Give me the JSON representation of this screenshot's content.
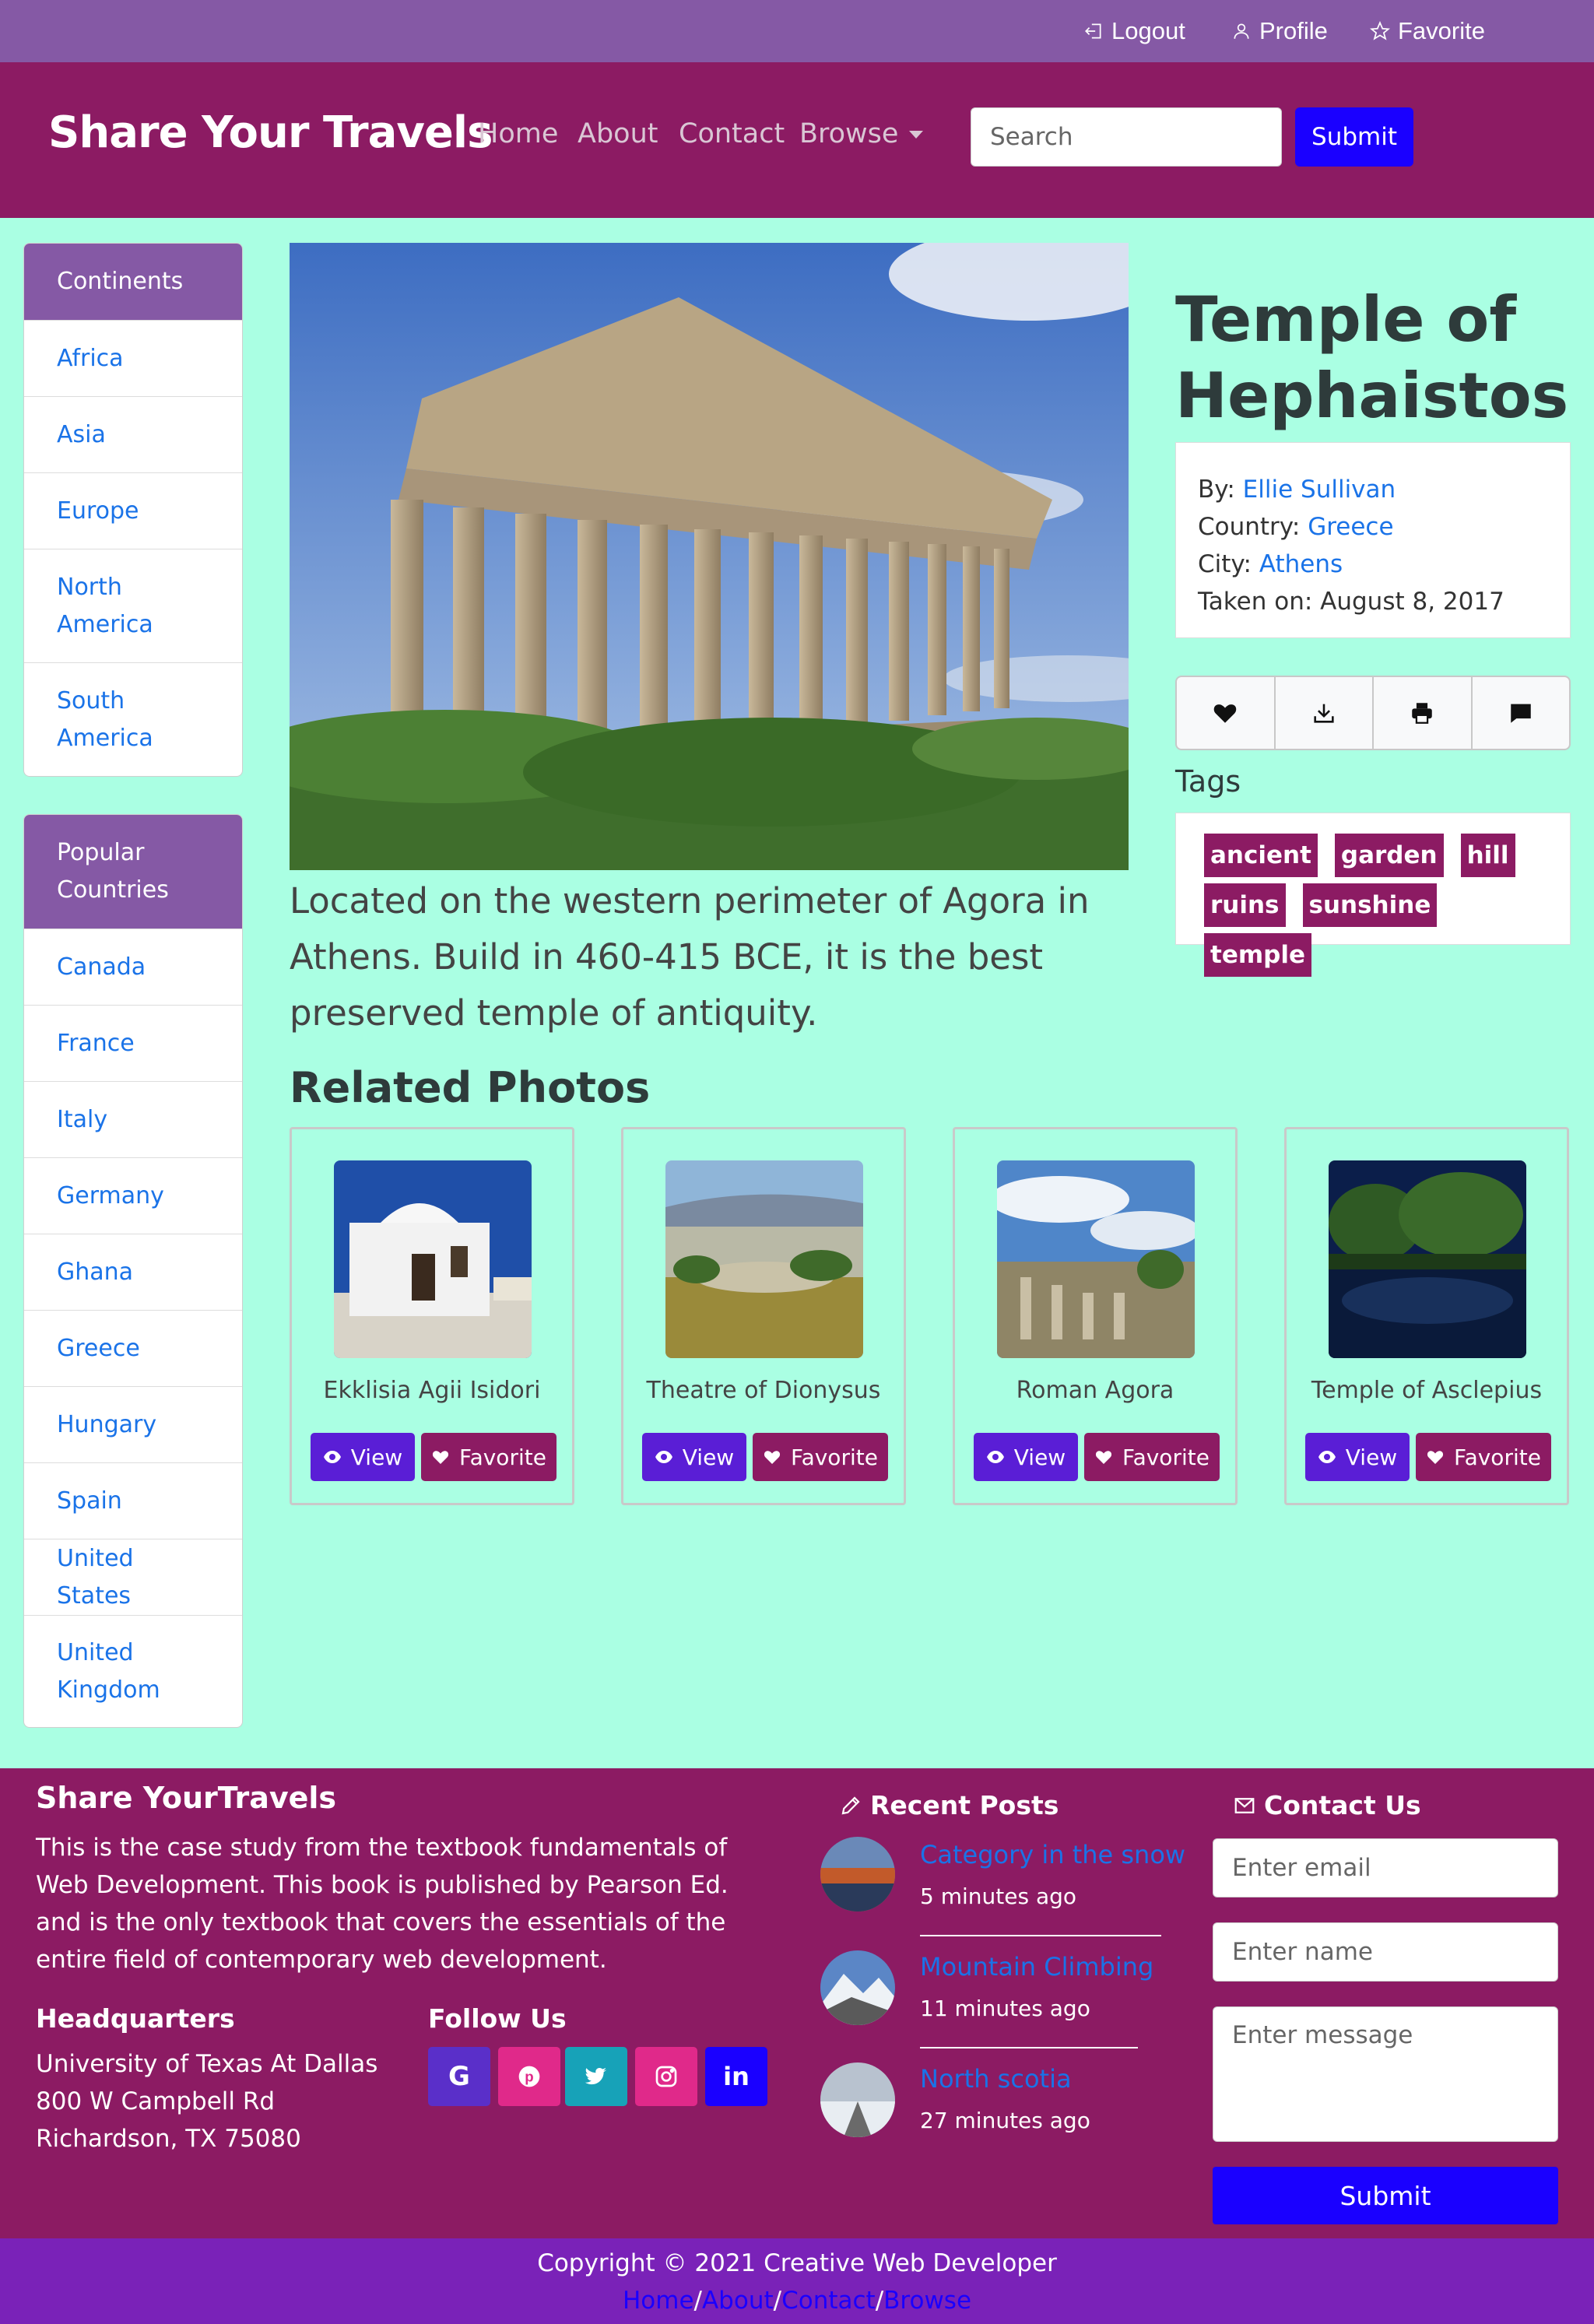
{
  "topbar": {
    "logout": "Logout",
    "profile": "Profile",
    "favorite": "Favorite"
  },
  "navbar": {
    "brand": "Share Your Travels",
    "links": [
      "Home",
      "About",
      "Contact",
      "Browse"
    ],
    "search_placeholder": "Search",
    "submit": "Submit"
  },
  "sidebar": {
    "continents_title": "Continents",
    "continents": [
      "Africa",
      "Asia",
      "Europe",
      "North America",
      "South America"
    ],
    "countries_title": "Popular Countries",
    "countries": [
      "Canada",
      "France",
      "Italy",
      "Germany",
      "Ghana",
      "Greece",
      "Hungary",
      "Spain",
      "United States",
      "United Kingdom"
    ]
  },
  "photo": {
    "title": "Temple of Hephaistos",
    "description": "Located on the western perimeter of Agora in Athens. Build in 460-415 BCE, it is the best preserved temple of antiquity.",
    "by_label": "By:",
    "by": "Ellie Sullivan",
    "country_label": "Country:",
    "country": "Greece",
    "city_label": "City:",
    "city": "Athens",
    "taken_label": "Taken on:",
    "taken": "August 8, 2017",
    "tags_title": "Tags",
    "tags": [
      "ancient",
      "garden",
      "hill",
      "ruins",
      "sunshine",
      "temple"
    ]
  },
  "related": {
    "title": "Related Photos",
    "view_label": "View",
    "favorite_label": "Favorite",
    "items": [
      {
        "name": "Ekklisia Agii Isidori"
      },
      {
        "name": "Theatre of Dionysus"
      },
      {
        "name": "Roman Agora"
      },
      {
        "name": "Temple of Asclepius"
      }
    ]
  },
  "footer": {
    "brand": "Share YourTravels",
    "about": "This is the case study from the textbook fundamentals of Web Development. This book is published by Pearson Ed. and is the only textbook that covers the essentials of the entire field of contemporary web development.",
    "hq_title": "Headquarters",
    "hq_lines": [
      "University of Texas At Dallas",
      "800 W Campbell Rd",
      "Richardson, TX 75080"
    ],
    "follow_title": "Follow Us",
    "social": [
      {
        "name": "google",
        "glyph": "G",
        "color": "#5a2fc9"
      },
      {
        "name": "pinterest",
        "glyph": "P",
        "color": "#e0298a"
      },
      {
        "name": "twitter",
        "glyph": "t",
        "color": "#17a2b8"
      },
      {
        "name": "instagram",
        "glyph": "◎",
        "color": "#e0298a"
      },
      {
        "name": "linkedin",
        "glyph": "in",
        "color": "#1a00ff"
      }
    ],
    "recent_title": "Recent Posts",
    "posts": [
      {
        "title": "Category in the snow",
        "time": "5 minutes ago"
      },
      {
        "title": "Mountain Climbing",
        "time": "11 minutes ago"
      },
      {
        "title": "North scotia",
        "time": "27 minutes ago"
      }
    ],
    "contact_title": "Contact Us",
    "email_placeholder": "Enter email",
    "name_placeholder": "Enter name",
    "message_placeholder": "Enter message",
    "submit": "Submit"
  },
  "copyright": {
    "text": "Copyright © 2021 Creative Web Developer",
    "links": [
      "Home",
      "About",
      "Contact",
      "Browse"
    ]
  },
  "colors": {
    "topbar": "#8559a5",
    "navbar": "#8c1b63",
    "accent_blue": "#1a00ff",
    "background": "#aaffe3",
    "view_button": "#5a1ed6"
  }
}
